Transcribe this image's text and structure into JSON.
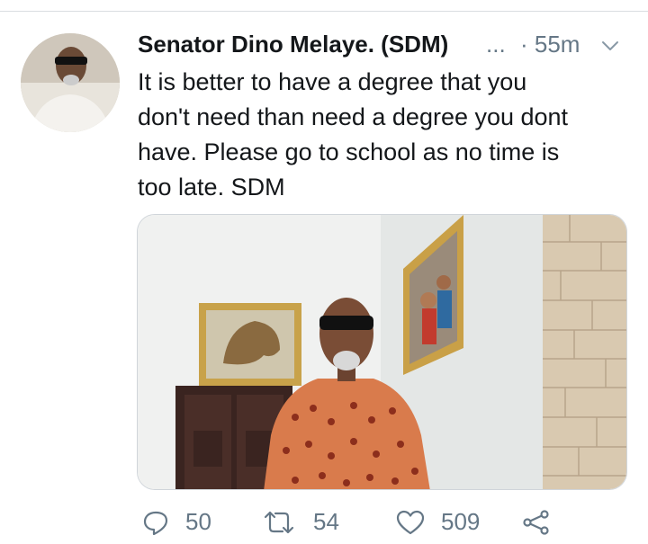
{
  "tweet": {
    "author_name": "Senator Dino Melaye. (SDM)",
    "handle_truncation": "...",
    "timestamp": "· 55m",
    "text": "It is better to have a degree that you\ndon't need than need a degree you dont\nhave. Please go to school as no time is\ntoo late. SDM"
  },
  "actions": {
    "reply_count": "50",
    "retweet_count": "54",
    "like_count": "509"
  },
  "icons": {
    "reply": "reply-icon",
    "retweet": "retweet-icon",
    "like": "heart-icon",
    "share": "share-icon",
    "menu": "chevron-down-icon"
  },
  "colors": {
    "text": "#14171a",
    "muted": "#657786",
    "divider": "#d9dde1"
  }
}
